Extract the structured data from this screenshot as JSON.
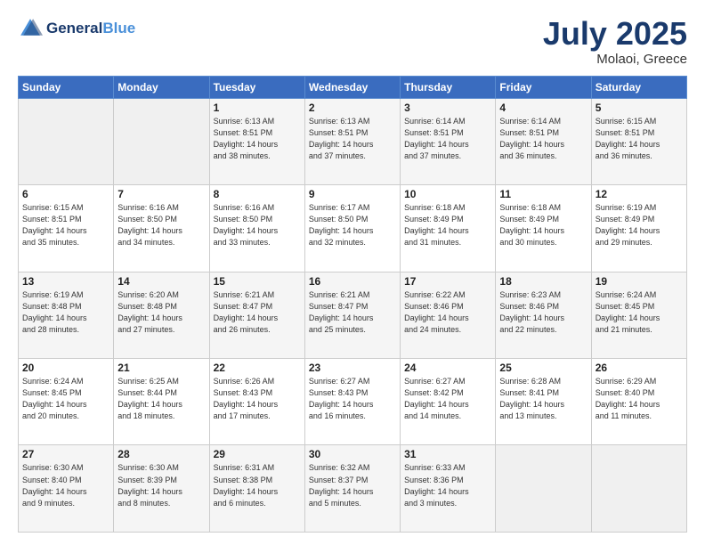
{
  "header": {
    "logo_line1": "General",
    "logo_line2": "Blue",
    "title": "July 2025",
    "location": "Molaoi, Greece"
  },
  "weekdays": [
    "Sunday",
    "Monday",
    "Tuesday",
    "Wednesday",
    "Thursday",
    "Friday",
    "Saturday"
  ],
  "weeks": [
    [
      {
        "day": "",
        "info": ""
      },
      {
        "day": "",
        "info": ""
      },
      {
        "day": "1",
        "info": "Sunrise: 6:13 AM\nSunset: 8:51 PM\nDaylight: 14 hours\nand 38 minutes."
      },
      {
        "day": "2",
        "info": "Sunrise: 6:13 AM\nSunset: 8:51 PM\nDaylight: 14 hours\nand 37 minutes."
      },
      {
        "day": "3",
        "info": "Sunrise: 6:14 AM\nSunset: 8:51 PM\nDaylight: 14 hours\nand 37 minutes."
      },
      {
        "day": "4",
        "info": "Sunrise: 6:14 AM\nSunset: 8:51 PM\nDaylight: 14 hours\nand 36 minutes."
      },
      {
        "day": "5",
        "info": "Sunrise: 6:15 AM\nSunset: 8:51 PM\nDaylight: 14 hours\nand 36 minutes."
      }
    ],
    [
      {
        "day": "6",
        "info": "Sunrise: 6:15 AM\nSunset: 8:51 PM\nDaylight: 14 hours\nand 35 minutes."
      },
      {
        "day": "7",
        "info": "Sunrise: 6:16 AM\nSunset: 8:50 PM\nDaylight: 14 hours\nand 34 minutes."
      },
      {
        "day": "8",
        "info": "Sunrise: 6:16 AM\nSunset: 8:50 PM\nDaylight: 14 hours\nand 33 minutes."
      },
      {
        "day": "9",
        "info": "Sunrise: 6:17 AM\nSunset: 8:50 PM\nDaylight: 14 hours\nand 32 minutes."
      },
      {
        "day": "10",
        "info": "Sunrise: 6:18 AM\nSunset: 8:49 PM\nDaylight: 14 hours\nand 31 minutes."
      },
      {
        "day": "11",
        "info": "Sunrise: 6:18 AM\nSunset: 8:49 PM\nDaylight: 14 hours\nand 30 minutes."
      },
      {
        "day": "12",
        "info": "Sunrise: 6:19 AM\nSunset: 8:49 PM\nDaylight: 14 hours\nand 29 minutes."
      }
    ],
    [
      {
        "day": "13",
        "info": "Sunrise: 6:19 AM\nSunset: 8:48 PM\nDaylight: 14 hours\nand 28 minutes."
      },
      {
        "day": "14",
        "info": "Sunrise: 6:20 AM\nSunset: 8:48 PM\nDaylight: 14 hours\nand 27 minutes."
      },
      {
        "day": "15",
        "info": "Sunrise: 6:21 AM\nSunset: 8:47 PM\nDaylight: 14 hours\nand 26 minutes."
      },
      {
        "day": "16",
        "info": "Sunrise: 6:21 AM\nSunset: 8:47 PM\nDaylight: 14 hours\nand 25 minutes."
      },
      {
        "day": "17",
        "info": "Sunrise: 6:22 AM\nSunset: 8:46 PM\nDaylight: 14 hours\nand 24 minutes."
      },
      {
        "day": "18",
        "info": "Sunrise: 6:23 AM\nSunset: 8:46 PM\nDaylight: 14 hours\nand 22 minutes."
      },
      {
        "day": "19",
        "info": "Sunrise: 6:24 AM\nSunset: 8:45 PM\nDaylight: 14 hours\nand 21 minutes."
      }
    ],
    [
      {
        "day": "20",
        "info": "Sunrise: 6:24 AM\nSunset: 8:45 PM\nDaylight: 14 hours\nand 20 minutes."
      },
      {
        "day": "21",
        "info": "Sunrise: 6:25 AM\nSunset: 8:44 PM\nDaylight: 14 hours\nand 18 minutes."
      },
      {
        "day": "22",
        "info": "Sunrise: 6:26 AM\nSunset: 8:43 PM\nDaylight: 14 hours\nand 17 minutes."
      },
      {
        "day": "23",
        "info": "Sunrise: 6:27 AM\nSunset: 8:43 PM\nDaylight: 14 hours\nand 16 minutes."
      },
      {
        "day": "24",
        "info": "Sunrise: 6:27 AM\nSunset: 8:42 PM\nDaylight: 14 hours\nand 14 minutes."
      },
      {
        "day": "25",
        "info": "Sunrise: 6:28 AM\nSunset: 8:41 PM\nDaylight: 14 hours\nand 13 minutes."
      },
      {
        "day": "26",
        "info": "Sunrise: 6:29 AM\nSunset: 8:40 PM\nDaylight: 14 hours\nand 11 minutes."
      }
    ],
    [
      {
        "day": "27",
        "info": "Sunrise: 6:30 AM\nSunset: 8:40 PM\nDaylight: 14 hours\nand 9 minutes."
      },
      {
        "day": "28",
        "info": "Sunrise: 6:30 AM\nSunset: 8:39 PM\nDaylight: 14 hours\nand 8 minutes."
      },
      {
        "day": "29",
        "info": "Sunrise: 6:31 AM\nSunset: 8:38 PM\nDaylight: 14 hours\nand 6 minutes."
      },
      {
        "day": "30",
        "info": "Sunrise: 6:32 AM\nSunset: 8:37 PM\nDaylight: 14 hours\nand 5 minutes."
      },
      {
        "day": "31",
        "info": "Sunrise: 6:33 AM\nSunset: 8:36 PM\nDaylight: 14 hours\nand 3 minutes."
      },
      {
        "day": "",
        "info": ""
      },
      {
        "day": "",
        "info": ""
      }
    ]
  ]
}
